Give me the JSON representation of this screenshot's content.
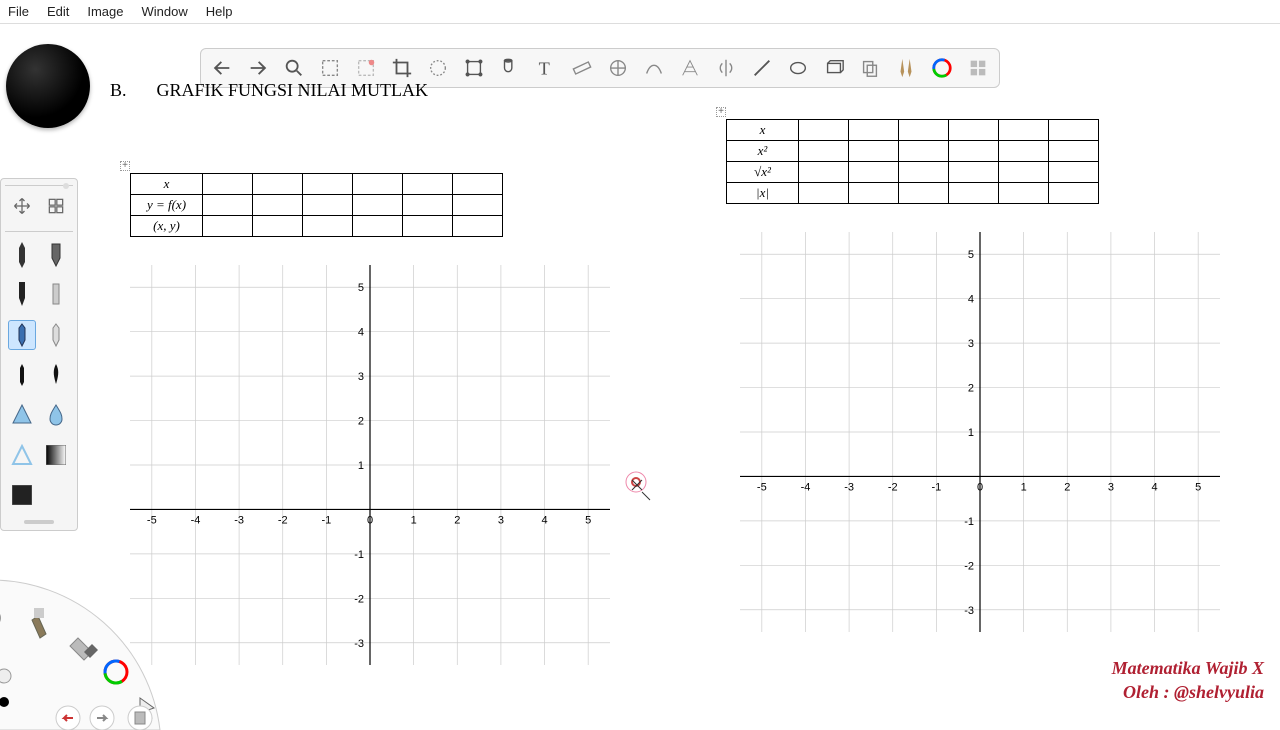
{
  "menu": {
    "file": "File",
    "edit": "Edit",
    "image": "Image",
    "window": "Window",
    "help": "Help"
  },
  "heading": {
    "letter": "B.",
    "title": "GRAFIK FUNGSI NILAI MUTLAK"
  },
  "table_left": {
    "rows": [
      "x",
      "y = f(x)",
      "(x, y)"
    ]
  },
  "table_right": {
    "rows": [
      "x",
      "x²",
      "√x²",
      "|x|"
    ]
  },
  "chart_data": [
    {
      "type": "scatter",
      "series": [],
      "x_ticks": [
        -5,
        -4,
        -3,
        -2,
        -1,
        0,
        1,
        2,
        3,
        4,
        5
      ],
      "y_ticks": [
        -3,
        -2,
        -1,
        0,
        1,
        2,
        3,
        4,
        5
      ],
      "xlim": [
        -5.5,
        5.5
      ],
      "ylim": [
        -3.5,
        5.5
      ],
      "title": "",
      "xlabel": "",
      "ylabel": ""
    },
    {
      "type": "scatter",
      "series": [],
      "x_ticks": [
        -5,
        -4,
        -3,
        -2,
        -1,
        0,
        1,
        2,
        3,
        4,
        5
      ],
      "y_ticks": [
        -3,
        -2,
        -1,
        0,
        1,
        2,
        3,
        4,
        5
      ],
      "xlim": [
        -5.5,
        5.5
      ],
      "ylim": [
        -3.5,
        5.5
      ],
      "title": "",
      "xlabel": "",
      "ylabel": ""
    }
  ],
  "watermark": {
    "line1": "Matematika Wajib X",
    "line2": "Oleh : @shelvyulia"
  }
}
